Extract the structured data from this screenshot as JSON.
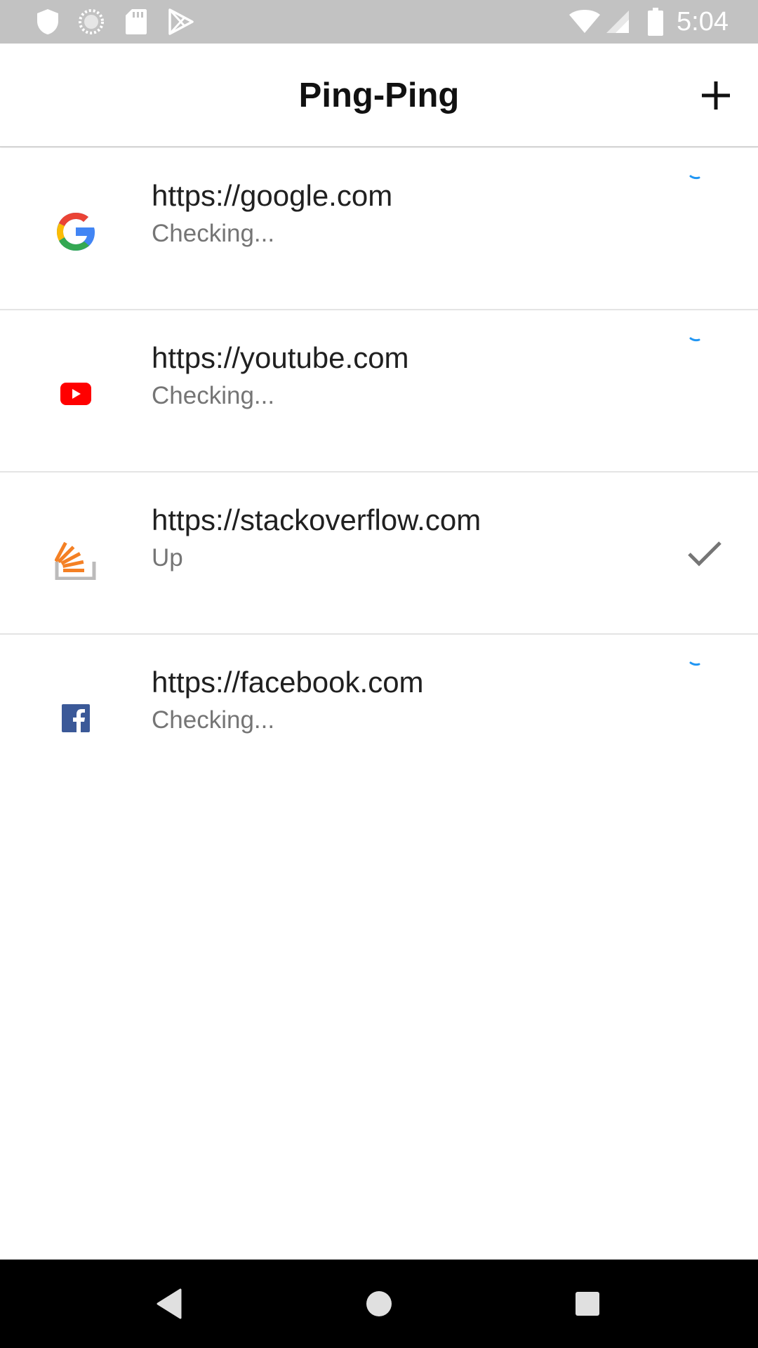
{
  "status_bar": {
    "time": "5:04",
    "left_icons": [
      "shield-icon",
      "sync-circle-icon",
      "sd-card-icon",
      "play-store-icon"
    ],
    "right_icons": [
      "wifi-icon",
      "cell-signal-icon",
      "battery-icon"
    ],
    "background": "#c2c2c2"
  },
  "app_bar": {
    "title": "Ping-Ping",
    "add_icon": "plus-icon"
  },
  "sites": [
    {
      "url": "https://google.com",
      "status": "Checking...",
      "favicon": "google-icon",
      "indicator": "loading-spinner"
    },
    {
      "url": "https://youtube.com",
      "status": "Checking...",
      "favicon": "youtube-icon",
      "indicator": "loading-spinner"
    },
    {
      "url": "https://stackoverflow.com",
      "status": "Up",
      "favicon": "stackoverflow-icon",
      "indicator": "check-icon"
    },
    {
      "url": "https://facebook.com",
      "status": "Checking...",
      "favicon": "facebook-icon",
      "indicator": "loading-spinner"
    }
  ],
  "nav_bar": {
    "buttons": [
      "back-icon",
      "home-icon",
      "recents-icon"
    ]
  },
  "colors": {
    "spinner": "#2196f3",
    "check": "#757575",
    "google_blue": "#4285f4",
    "google_red": "#ea4335",
    "google_yellow": "#fbbc05",
    "google_green": "#34a853",
    "youtube_red": "#ff0000",
    "stackoverflow_orange": "#f48024",
    "stackoverflow_gray": "#bcbbbb",
    "facebook_blue": "#3b5998"
  }
}
